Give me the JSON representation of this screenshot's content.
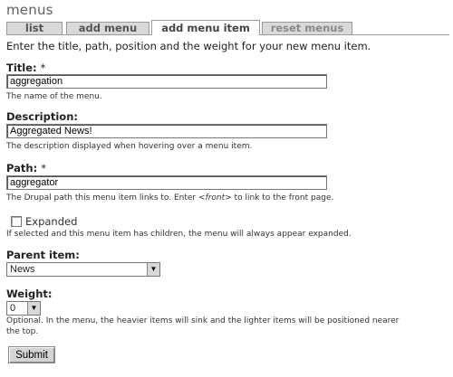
{
  "page": {
    "title": "menus"
  },
  "tabs": [
    {
      "label": "list"
    },
    {
      "label": "add menu"
    },
    {
      "label": "add menu item"
    },
    {
      "label": "reset menus"
    }
  ],
  "intro": "Enter the title, path, position and the weight for your new menu item.",
  "fields": {
    "title": {
      "label": "Title:",
      "required_mark": "*",
      "value": "aggregation",
      "description": "The name of the menu."
    },
    "description": {
      "label": "Description:",
      "value": "Aggregated News!",
      "description": "The description displayed when hovering over a menu item."
    },
    "path": {
      "label": "Path:",
      "required_mark": "*",
      "value": "aggregator",
      "description_before": "The Drupal path this menu item links to. Enter ",
      "description_em": "<front>",
      "description_after": " to link to the front page."
    },
    "expanded": {
      "label": "Expanded",
      "checked": false,
      "description": "If selected and this menu item has children, the menu will always appear expanded."
    },
    "parent": {
      "label": "Parent item:",
      "selected": "News"
    },
    "weight": {
      "label": "Weight:",
      "selected": "0",
      "description_line1": "Optional. In the menu, the heavier items will sink and the lighter items will be positioned nearer",
      "description_line2": "the top."
    }
  },
  "submit_label": "Submit"
}
